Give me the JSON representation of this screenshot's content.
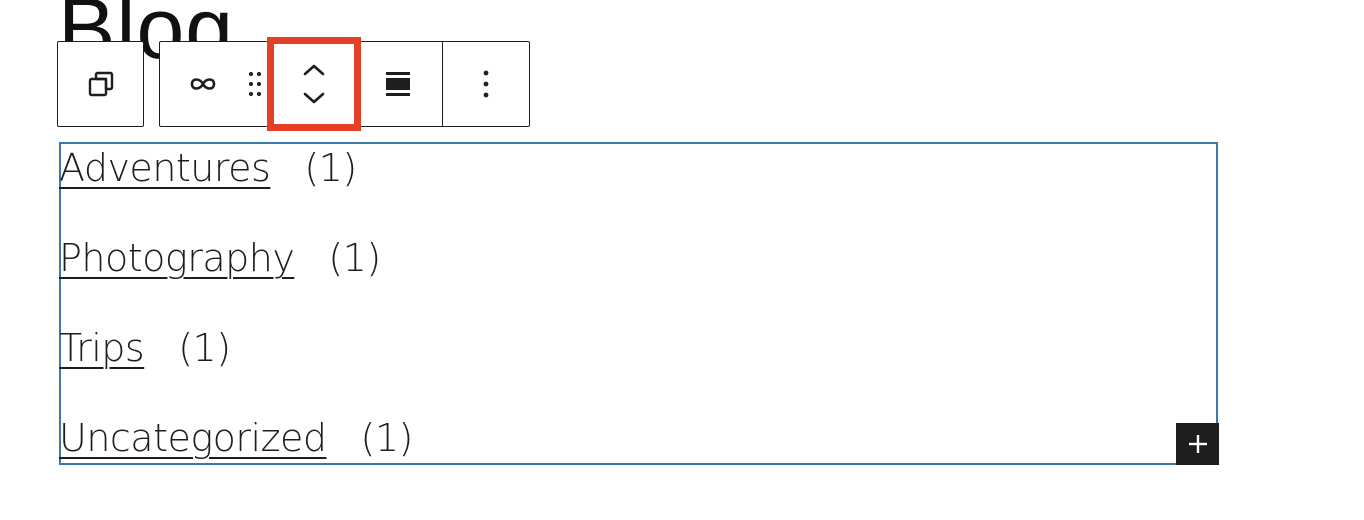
{
  "page": {
    "heading": "Blog"
  },
  "toolbar": {
    "parent": {
      "icon": "select-parent-icon"
    },
    "buttons": [
      {
        "icon": "categories-block-icon"
      },
      {
        "icon": "drag-handle-icon"
      },
      {
        "icon": "move-up-down-icon",
        "highlighted": true
      },
      {
        "icon": "align-icon"
      },
      {
        "icon": "more-options-icon"
      }
    ]
  },
  "categories": [
    {
      "name": "Adventures",
      "count": "(1)"
    },
    {
      "name": "Photography",
      "count": "(1)"
    },
    {
      "name": "Trips",
      "count": "(1)"
    },
    {
      "name": "Uncategorized",
      "count": "(1)"
    }
  ],
  "add_block": {
    "icon": "plus-icon"
  },
  "colors": {
    "highlight": "#e43f27",
    "selection_outline": "#3d77b0",
    "dark": "#1e1e1e"
  }
}
